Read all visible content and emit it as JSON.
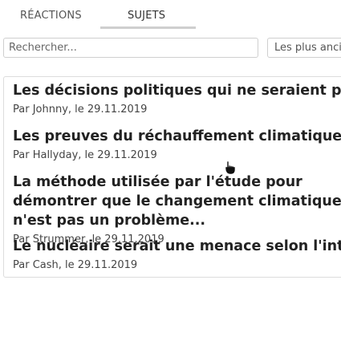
{
  "tabs": [
    {
      "label": "RÉACTIONS",
      "active": false
    },
    {
      "label": "SUJETS",
      "active": true
    }
  ],
  "search": {
    "placeholder": "Rechercher...",
    "value": ""
  },
  "sort": {
    "selected": "Les plus anciens"
  },
  "topics": [
    {
      "title": "Les décisions politiques qui ne seraient pas en accord avec",
      "meta": "Par Johnny, le 29.11.2019"
    },
    {
      "title": "Les preuves du réchauffement climatiques avancées par",
      "meta": "Par Hallyday, le 29.11.2019"
    },
    {
      "title": "La méthode utilisée par l'étude pour démontrer que le changement climatique n'est pas un problème...",
      "meta": "Par Strummer, le 29.11.2019"
    },
    {
      "title": "Le nucléaire serait une menace selon l'intervenant",
      "meta": "Par Cash, le 29.11.2019"
    }
  ],
  "colors": {
    "tab_underline": "#cfcfcf",
    "border": "#dcdcdc",
    "text": "#222222"
  },
  "icons": {
    "cursor": "hand-pointer-icon"
  }
}
